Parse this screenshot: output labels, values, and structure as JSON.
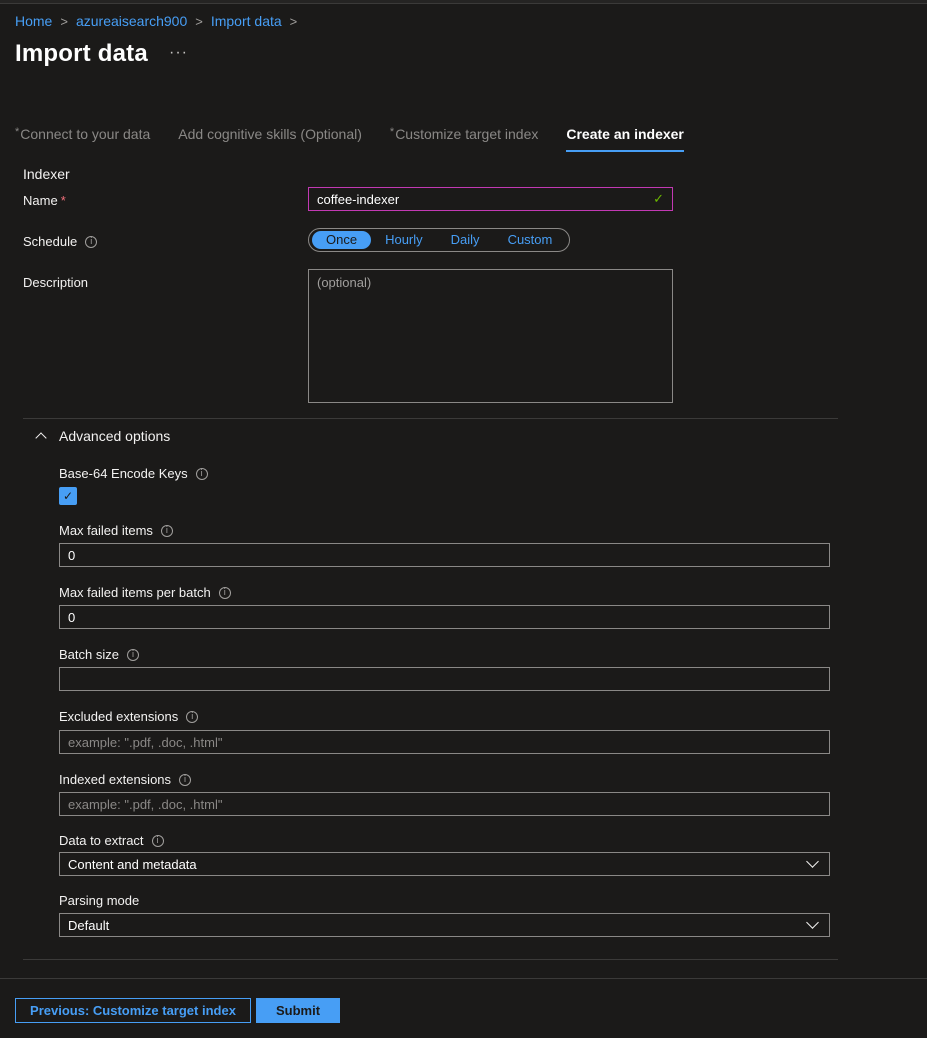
{
  "breadcrumb": [
    "Home",
    "azureaisearch900",
    "Import data"
  ],
  "page": {
    "title": "Import data",
    "more": "···"
  },
  "tabs": [
    {
      "label": "Connect to your data",
      "required": true
    },
    {
      "label": "Add cognitive skills (Optional)",
      "required": false
    },
    {
      "label": "Customize target index",
      "required": true
    },
    {
      "label": "Create an indexer",
      "required": false,
      "active": true
    }
  ],
  "indexer": {
    "section": "Indexer",
    "name_label": "Name",
    "name_value": "coffee-indexer",
    "schedule_label": "Schedule",
    "schedule_options": [
      "Once",
      "Hourly",
      "Daily",
      "Custom"
    ],
    "schedule_selected": "Once",
    "description_label": "Description",
    "description_placeholder": "(optional)"
  },
  "advanced": {
    "label": "Advanced options",
    "base64_label": "Base-64 Encode Keys",
    "base64_checked": true,
    "max_failed_label": "Max failed items",
    "max_failed_value": "0",
    "max_failed_batch_label": "Max failed items per batch",
    "max_failed_batch_value": "0",
    "batch_size_label": "Batch size",
    "batch_size_value": "",
    "excluded_label": "Excluded extensions",
    "excluded_placeholder": "example: \".pdf, .doc, .html\"",
    "indexed_label": "Indexed extensions",
    "indexed_placeholder": "example: \".pdf, .doc, .html\"",
    "extract_label": "Data to extract",
    "extract_value": "Content and metadata",
    "parsing_label": "Parsing mode",
    "parsing_value": "Default"
  },
  "footer": {
    "previous_label": "Previous: Customize target index",
    "submit_label": "Submit"
  },
  "colors": {
    "accent": "#479ef5",
    "background": "#1b1a19",
    "focus_border": "#c239b3",
    "valid": "#6bb700"
  }
}
